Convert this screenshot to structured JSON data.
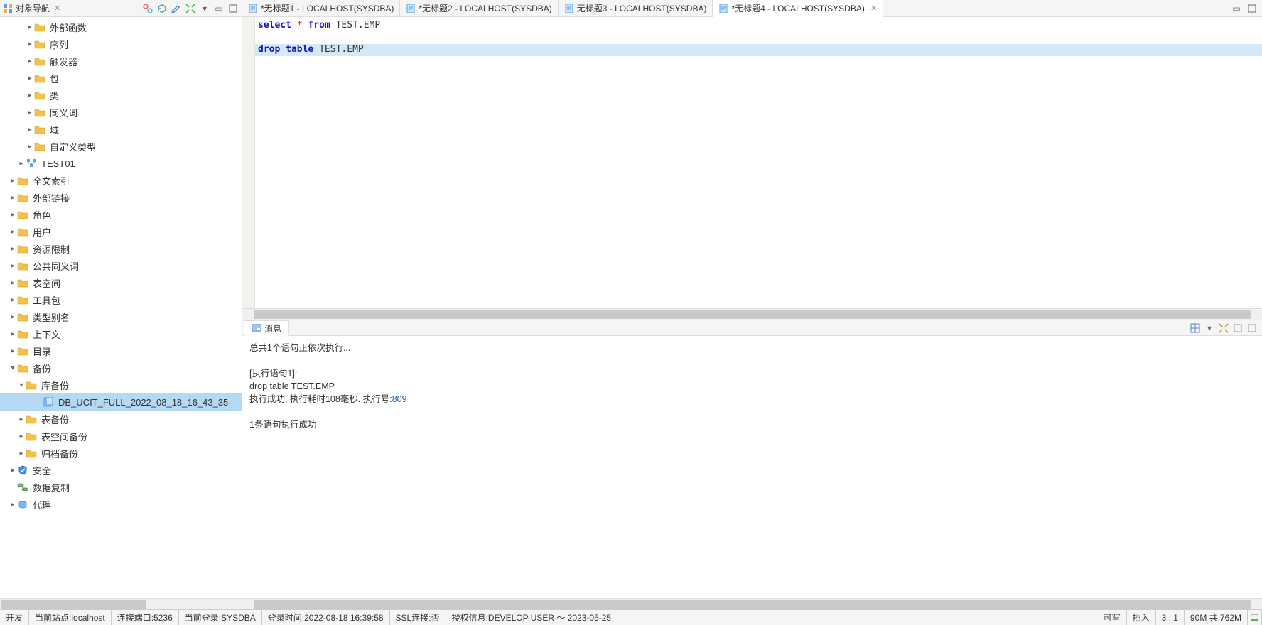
{
  "sidebar": {
    "title": "对象导航",
    "items": [
      {
        "label": "外部函数",
        "indent": 30,
        "expand": "col",
        "icon": "folder"
      },
      {
        "label": "序列",
        "indent": 30,
        "expand": "col",
        "icon": "folder"
      },
      {
        "label": "触发器",
        "indent": 30,
        "expand": "col",
        "icon": "folder"
      },
      {
        "label": "包",
        "indent": 30,
        "expand": "col",
        "icon": "folder"
      },
      {
        "label": "类",
        "indent": 30,
        "expand": "col",
        "icon": "folder"
      },
      {
        "label": "同义词",
        "indent": 30,
        "expand": "col",
        "icon": "folder"
      },
      {
        "label": "域",
        "indent": 30,
        "expand": "col",
        "icon": "folder"
      },
      {
        "label": "自定义类型",
        "indent": 30,
        "expand": "col",
        "icon": "folder"
      },
      {
        "label": "TEST01",
        "indent": 18,
        "expand": "col",
        "icon": "schema"
      },
      {
        "label": "全文索引",
        "indent": 6,
        "expand": "col",
        "icon": "folder"
      },
      {
        "label": "外部链接",
        "indent": 6,
        "expand": "col",
        "icon": "folder"
      },
      {
        "label": "角色",
        "indent": 6,
        "expand": "col",
        "icon": "folder"
      },
      {
        "label": "用户",
        "indent": 6,
        "expand": "col",
        "icon": "folder"
      },
      {
        "label": "资源限制",
        "indent": 6,
        "expand": "col",
        "icon": "folder"
      },
      {
        "label": "公共同义词",
        "indent": 6,
        "expand": "col",
        "icon": "folder"
      },
      {
        "label": "表空间",
        "indent": 6,
        "expand": "col",
        "icon": "folder"
      },
      {
        "label": "工具包",
        "indent": 6,
        "expand": "col",
        "icon": "folder"
      },
      {
        "label": "类型别名",
        "indent": 6,
        "expand": "col",
        "icon": "folder"
      },
      {
        "label": "上下文",
        "indent": 6,
        "expand": "col",
        "icon": "folder"
      },
      {
        "label": "目录",
        "indent": 6,
        "expand": "col",
        "icon": "folder"
      },
      {
        "label": "备份",
        "indent": 6,
        "expand": "exp",
        "icon": "folder"
      },
      {
        "label": "库备份",
        "indent": 18,
        "expand": "exp",
        "icon": "folder"
      },
      {
        "label": "DB_UCIT_FULL_2022_08_18_16_43_35",
        "indent": 42,
        "expand": "none",
        "icon": "backup",
        "sel": true
      },
      {
        "label": "表备份",
        "indent": 18,
        "expand": "col",
        "icon": "folder"
      },
      {
        "label": "表空间备份",
        "indent": 18,
        "expand": "col",
        "icon": "folder"
      },
      {
        "label": "归档备份",
        "indent": 18,
        "expand": "col",
        "icon": "folder"
      },
      {
        "label": "安全",
        "indent": 6,
        "expand": "col",
        "icon": "shield"
      },
      {
        "label": "数据复制",
        "indent": 6,
        "expand": "none",
        "icon": "replica"
      },
      {
        "label": "代理",
        "indent": 6,
        "expand": "col",
        "icon": "agent"
      }
    ]
  },
  "tabs": [
    {
      "label": "*无标题1 - LOCALHOST(SYSDBA)",
      "active": false
    },
    {
      "label": "*无标题2 - LOCALHOST(SYSDBA)",
      "active": false
    },
    {
      "label": "无标题3 - LOCALHOST(SYSDBA)",
      "active": false
    },
    {
      "label": "*无标题4 - LOCALHOST(SYSDBA)",
      "active": true
    }
  ],
  "editor": {
    "line1": {
      "kw1": "select",
      "op": " * ",
      "kw2": "from",
      "id": " TEST.EMP"
    },
    "line3": {
      "kw1": "drop",
      "kw2": " table",
      "id": " TEST.EMP"
    }
  },
  "messages": {
    "tab_label": "消息",
    "l1": "总共1个语句正依次执行...",
    "l2": "[执行语句1]:",
    "l3": "drop table TEST.EMP",
    "l4a": "执行成功, 执行耗时108毫秒. 执行号:",
    "l4b": "809",
    "l5": "1条语句执行成功"
  },
  "status": {
    "s0": "开发",
    "s1": "当前站点:localhost",
    "s2": "连接端口:5236",
    "s3": "当前登录:SYSDBA",
    "s4": "登录时间:2022-08-18 16:39:58",
    "s5": "SSL连接:否",
    "s6": "授权信息:DEVELOP USER ～ 2023-05-25",
    "r1": "可写",
    "r2": "插入",
    "r3": "3 : 1",
    "r4": "90M 共 762M"
  }
}
